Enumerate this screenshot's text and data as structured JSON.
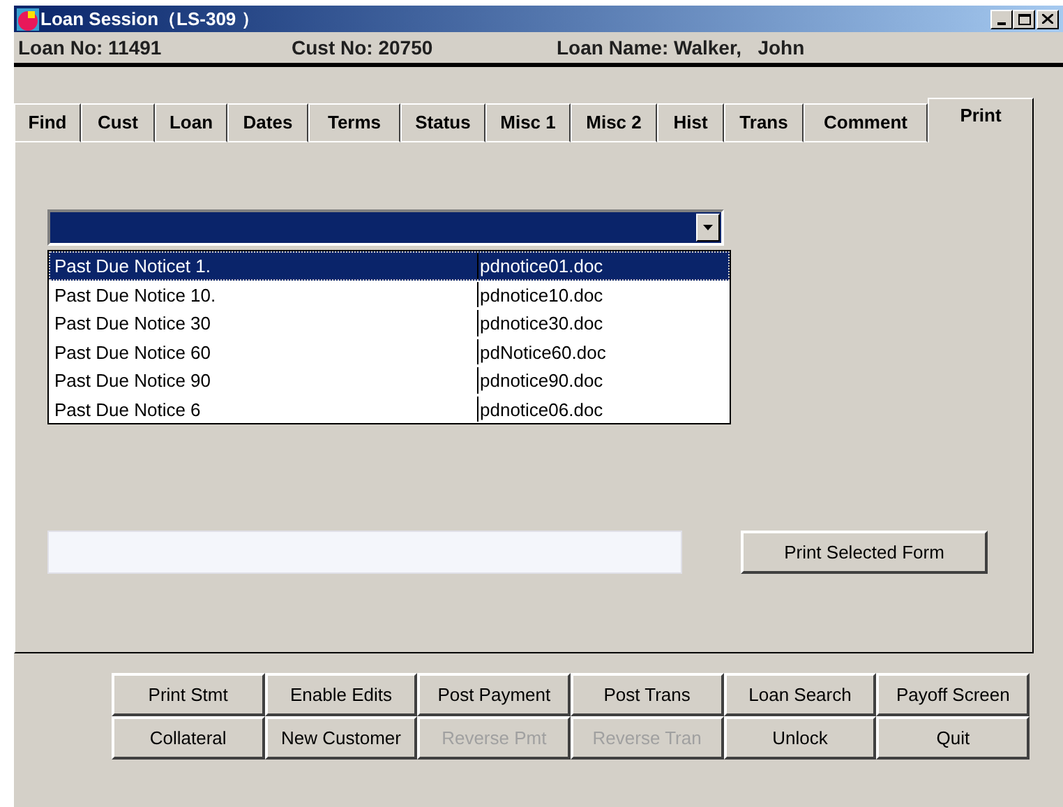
{
  "window": {
    "title": "Loan Session（LS-309 ）"
  },
  "info": [
    {
      "label": "Loan No:",
      "value": "11491"
    },
    {
      "label": "Cust No:",
      "value": "20750"
    },
    {
      "label": "Loan Name:",
      "value": "Walker,   John"
    }
  ],
  "tabs": [
    {
      "label": "Find",
      "selected": false
    },
    {
      "label": "Cust",
      "selected": false
    },
    {
      "label": "Loan",
      "selected": false
    },
    {
      "label": "Dates",
      "selected": false
    },
    {
      "label": "Terms",
      "selected": false
    },
    {
      "label": "Status",
      "selected": false
    },
    {
      "label": "Misc 1",
      "selected": false
    },
    {
      "label": "Misc 2",
      "selected": false
    },
    {
      "label": "Hist",
      "selected": false
    },
    {
      "label": "Trans",
      "selected": false
    },
    {
      "label": "Comment",
      "selected": false
    },
    {
      "label": "Print",
      "selected": true
    }
  ],
  "form_list": [
    {
      "name": "Past Due Noticet 1.",
      "file": "pdnotice01.doc",
      "selected": true
    },
    {
      "name": "Past Due Notice 10.",
      "file": "pdnotice10.doc",
      "selected": false
    },
    {
      "name": "Past Due Notice 30",
      "file": "pdnotice30.doc",
      "selected": false
    },
    {
      "name": "Past Due Notice 60",
      "file": "pdNotice60.doc",
      "selected": false
    },
    {
      "name": "Past Due Notice 90",
      "file": "pdnotice90.doc",
      "selected": false
    },
    {
      "name": "Past Due Notice 6",
      "file": "pdnotice06.doc",
      "selected": false
    }
  ],
  "print_button": "Print Selected Form",
  "buttons": [
    {
      "label": "Print Stmt",
      "disabled": false
    },
    {
      "label": "Enable Edits",
      "disabled": false
    },
    {
      "label": "Post Payment",
      "disabled": false
    },
    {
      "label": "Post Trans",
      "disabled": false
    },
    {
      "label": "Loan Search",
      "disabled": false
    },
    {
      "label": "Payoff Screen",
      "disabled": false
    },
    {
      "label": "Collateral",
      "disabled": false
    },
    {
      "label": "New Customer",
      "disabled": false
    },
    {
      "label": "Reverse Pmt",
      "disabled": true
    },
    {
      "label": "Reverse Tran",
      "disabled": true
    },
    {
      "label": "Unlock",
      "disabled": false
    },
    {
      "label": "Quit",
      "disabled": false
    }
  ]
}
